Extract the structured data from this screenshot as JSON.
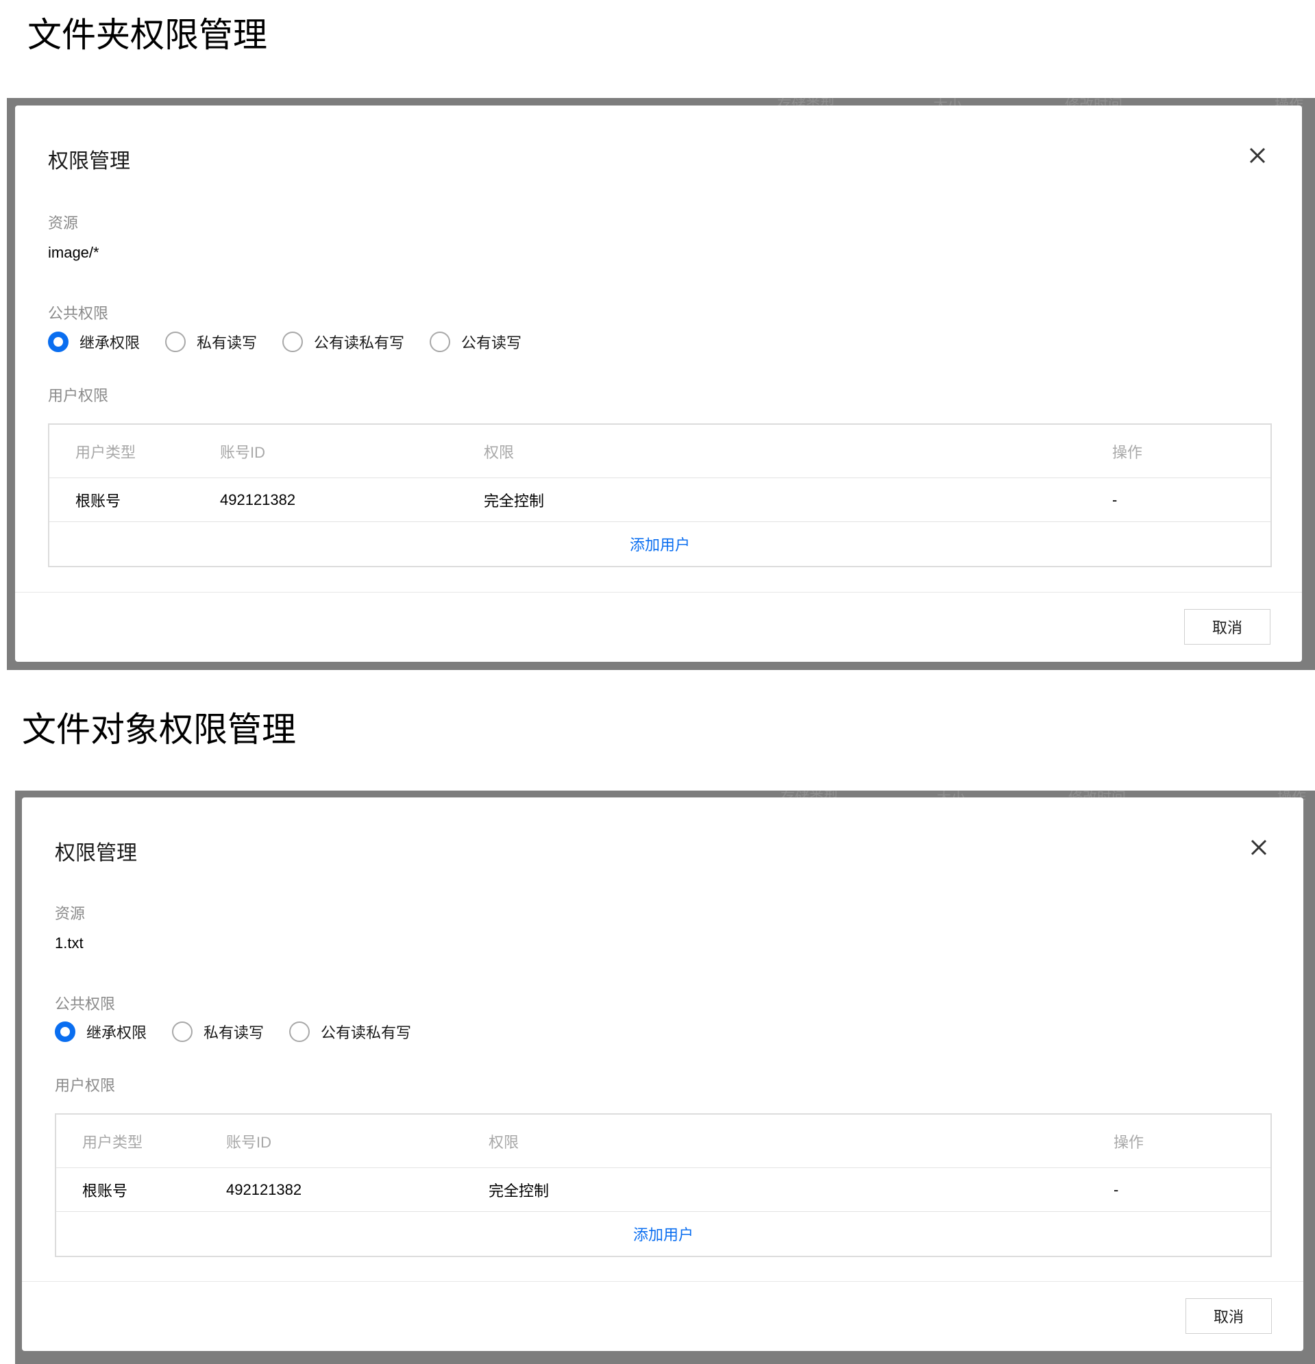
{
  "sections": [
    {
      "title": "文件夹权限管理",
      "background_headers": [
        "存储类型",
        "大小",
        "修改时间",
        "操作"
      ],
      "dialog": {
        "title": "权限管理",
        "resource_label": "资源",
        "resource_value": "image/*",
        "public_permission_label": "公共权限",
        "radio_options": [
          {
            "label": "继承权限",
            "checked": true
          },
          {
            "label": "私有读写",
            "checked": false
          },
          {
            "label": "公有读私有写",
            "checked": false
          },
          {
            "label": "公有读写",
            "checked": false
          }
        ],
        "user_permission_label": "用户权限",
        "table": {
          "columns": [
            "用户类型",
            "账号ID",
            "权限",
            "操作"
          ],
          "rows": [
            [
              "根账号",
              "492121382",
              "完全控制",
              "-"
            ]
          ],
          "add_user_label": "添加用户"
        },
        "cancel_label": "取消"
      }
    },
    {
      "title": "文件对象权限管理",
      "background_headers": [
        "存储类型",
        "大小",
        "修改时间",
        "操作"
      ],
      "dialog": {
        "title": "权限管理",
        "resource_label": "资源",
        "resource_value": "1.txt",
        "public_permission_label": "公共权限",
        "radio_options": [
          {
            "label": "继承权限",
            "checked": true
          },
          {
            "label": "私有读写",
            "checked": false
          },
          {
            "label": "公有读私有写",
            "checked": false
          }
        ],
        "user_permission_label": "用户权限",
        "table": {
          "columns": [
            "用户类型",
            "账号ID",
            "权限",
            "操作"
          ],
          "rows": [
            [
              "根账号",
              "492121382",
              "完全控制",
              "-"
            ]
          ],
          "add_user_label": "添加用户"
        },
        "cancel_label": "取消"
      }
    }
  ],
  "colors": {
    "accent": "#0a6ef0",
    "overlay": "#7d7d7d",
    "muted_label": "#8a8a8a",
    "table_header": "#a8a8a8"
  },
  "icons": {
    "close": "close-icon",
    "radio_checked": "radio-checked-icon",
    "radio_unchecked": "radio-unchecked-icon"
  }
}
